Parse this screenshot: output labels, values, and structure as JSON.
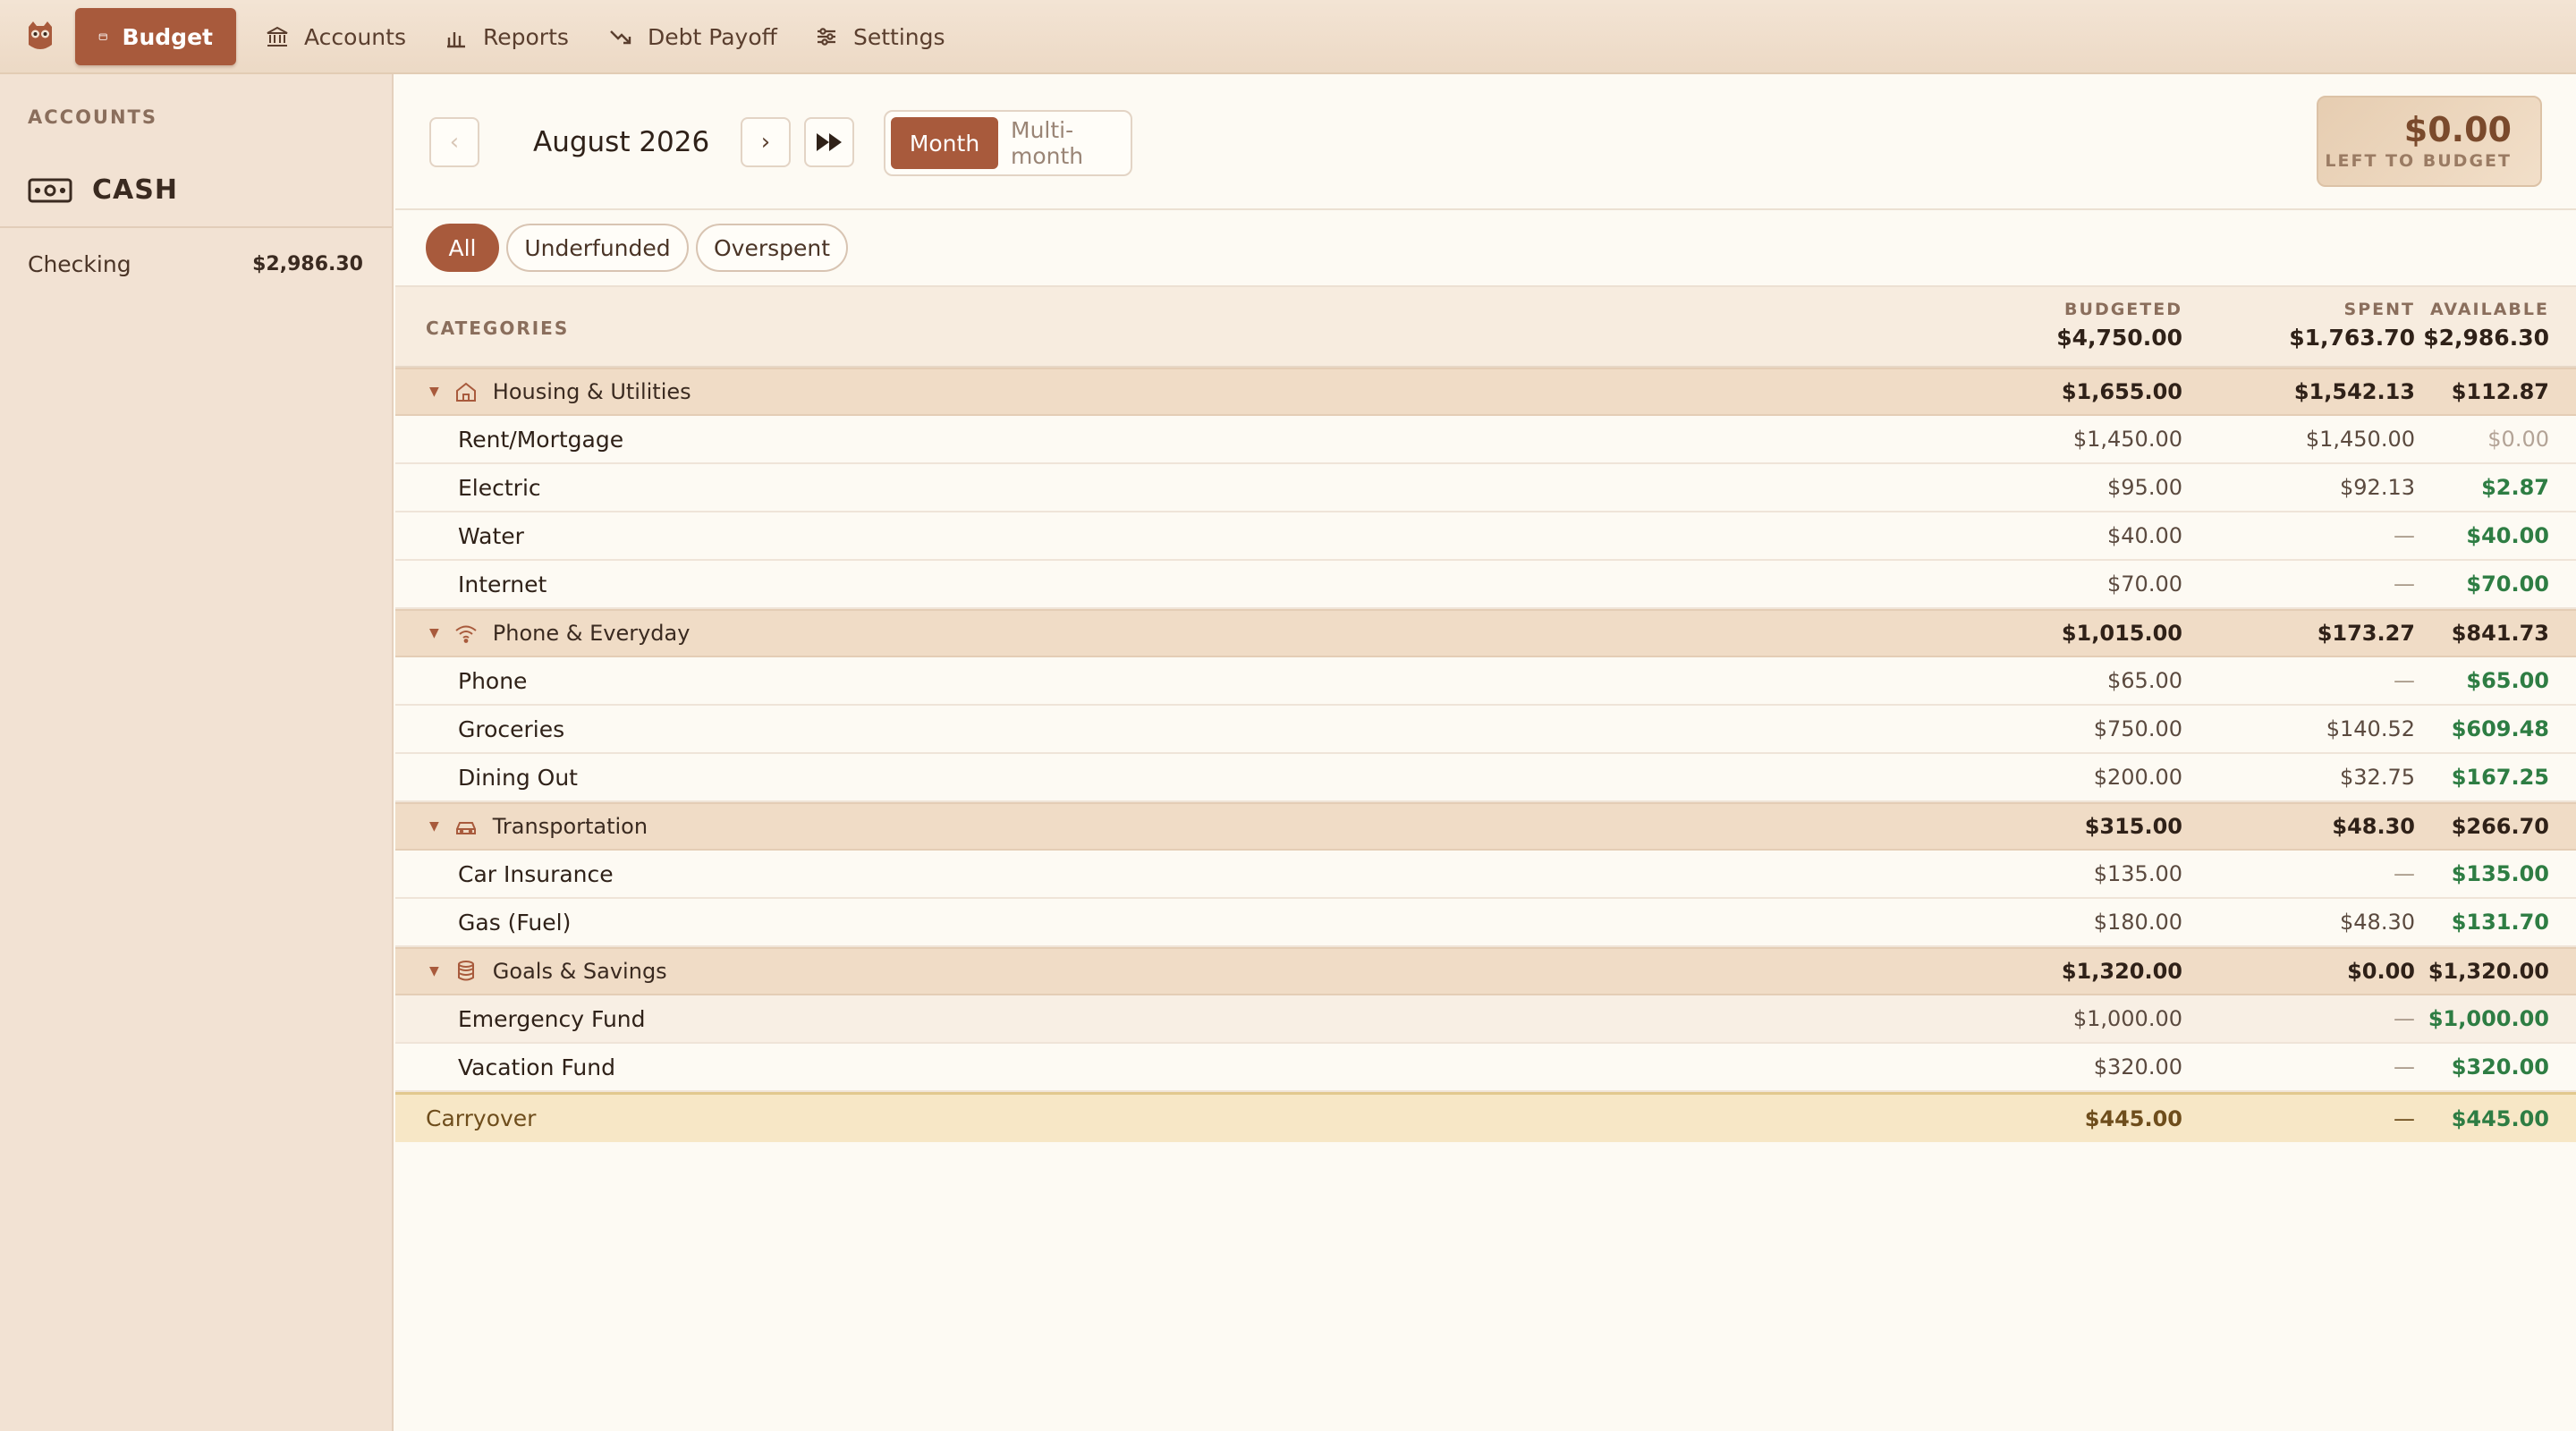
{
  "nav": {
    "items": [
      {
        "label": "Budget",
        "icon": "wallet-icon",
        "active": true
      },
      {
        "label": "Accounts",
        "icon": "bank-icon"
      },
      {
        "label": "Reports",
        "icon": "bar-chart-icon"
      },
      {
        "label": "Debt Payoff",
        "icon": "trend-down-icon"
      },
      {
        "label": "Settings",
        "icon": "sliders-icon"
      }
    ]
  },
  "sidebar": {
    "heading": "ACCOUNTS",
    "group_label": "CASH",
    "accounts": [
      {
        "name": "Checking",
        "balance": "$2,986.30"
      }
    ]
  },
  "header": {
    "month": "August 2026",
    "prev": "‹",
    "next": "›",
    "view_month": "Month",
    "view_multi": "Multi-month",
    "left_amount": "$0.00",
    "left_label": "LEFT TO BUDGET"
  },
  "filters": [
    "All",
    "Underfunded",
    "Overspent"
  ],
  "table": {
    "col_categories": "CATEGORIES",
    "col_budgeted": "BUDGETED",
    "col_spent": "SPENT",
    "col_available": "AVAILABLE",
    "total_budgeted": "$4,750.00",
    "total_spent": "$1,763.70",
    "total_available": "$2,986.30",
    "groups": [
      {
        "name": "Housing & Utilities",
        "budgeted": "$1,655.00",
        "spent": "$1,542.13",
        "available": "$112.87",
        "rows": [
          {
            "name": "Rent/Mortgage",
            "budgeted": "$1,450.00",
            "spent": "$1,450.00",
            "available": "$0.00"
          },
          {
            "name": "Electric",
            "budgeted": "$95.00",
            "spent": "$92.13",
            "available": "$2.87"
          },
          {
            "name": "Water",
            "budgeted": "$40.00",
            "spent": "—",
            "available": "$40.00"
          },
          {
            "name": "Internet",
            "budgeted": "$70.00",
            "spent": "—",
            "available": "$70.00"
          }
        ]
      },
      {
        "name": "Phone & Everyday",
        "budgeted": "$1,015.00",
        "spent": "$173.27",
        "available": "$841.73",
        "rows": [
          {
            "name": "Phone",
            "budgeted": "$65.00",
            "spent": "—",
            "available": "$65.00"
          },
          {
            "name": "Groceries",
            "budgeted": "$750.00",
            "spent": "$140.52",
            "available": "$609.48"
          },
          {
            "name": "Dining Out",
            "budgeted": "$200.00",
            "spent": "$32.75",
            "available": "$167.25"
          }
        ]
      },
      {
        "name": "Transportation",
        "budgeted": "$315.00",
        "spent": "$48.30",
        "available": "$266.70",
        "rows": [
          {
            "name": "Car Insurance",
            "budgeted": "$135.00",
            "spent": "—",
            "available": "$135.00"
          },
          {
            "name": "Gas (Fuel)",
            "budgeted": "$180.00",
            "spent": "$48.30",
            "available": "$131.70"
          }
        ]
      },
      {
        "name": "Goals & Savings",
        "budgeted": "$1,320.00",
        "spent": "$0.00",
        "available": "$1,320.00",
        "rows": [
          {
            "name": "Emergency Fund",
            "budgeted": "$1,000.00",
            "spent": "—",
            "available": "$1,000.00"
          },
          {
            "name": "Vacation Fund",
            "budgeted": "$320.00",
            "spent": "—",
            "available": "$320.00"
          }
        ]
      }
    ],
    "carryover": {
      "name": "Carryover",
      "budgeted": "$445.00",
      "spent": "—",
      "available": "$445.00"
    }
  },
  "colors": {
    "accent": "#a85a3c",
    "positive": "#2e7d43",
    "sidebar": "#f2e2d3"
  }
}
